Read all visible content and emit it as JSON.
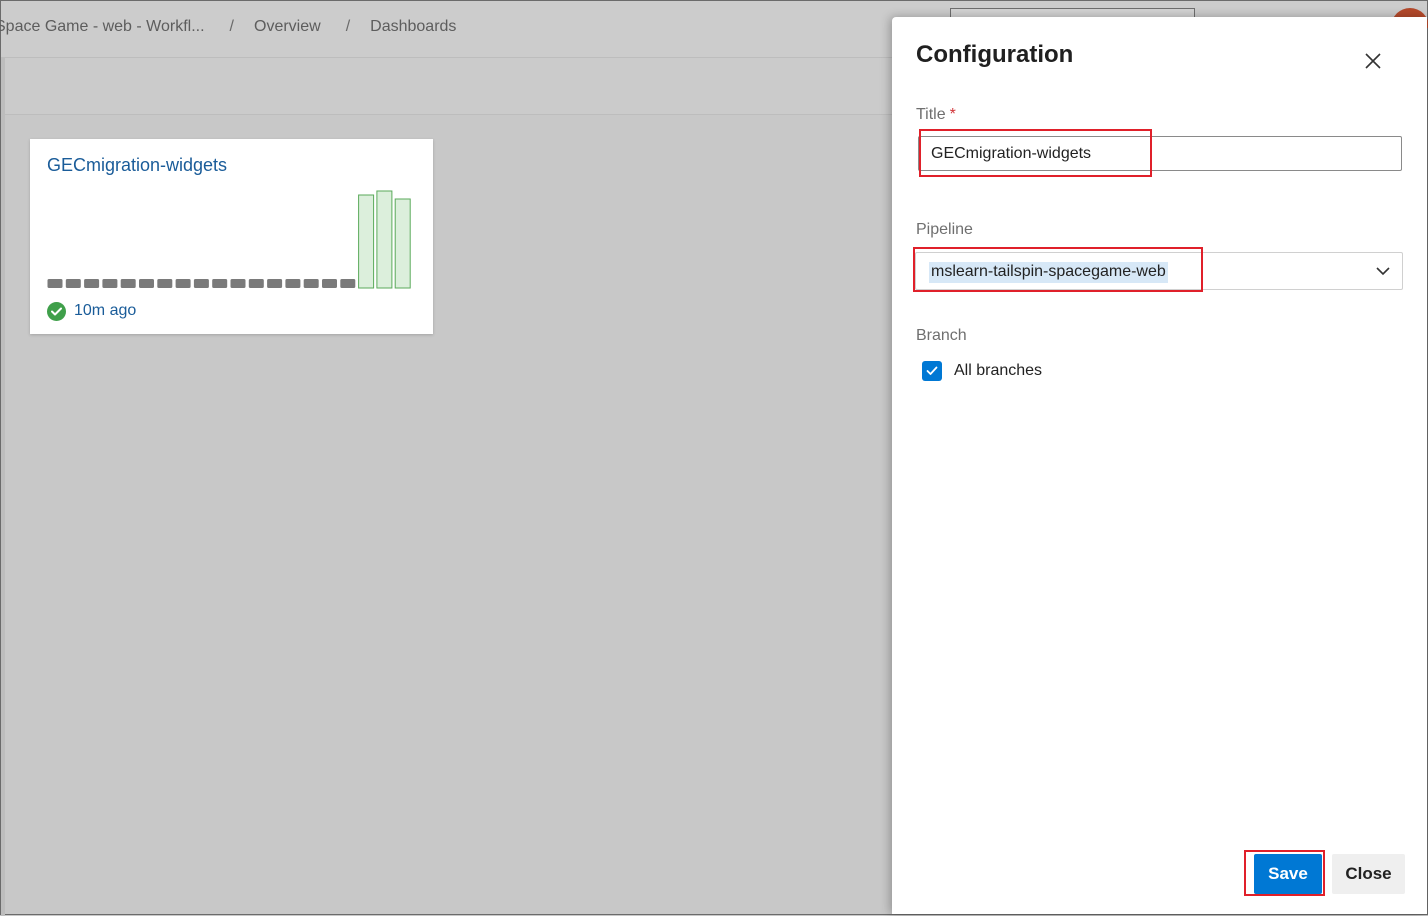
{
  "breadcrumb": {
    "items": [
      "Space Game - web - Workfl...",
      "Overview",
      "Dashboards"
    ],
    "separator": "/"
  },
  "widget": {
    "title": "GECmigration-widgets",
    "status_time": "10m ago",
    "status_icon": "check-circle-icon",
    "build_history": {
      "builds": [
        "none",
        "none",
        "none",
        "none",
        "none",
        "none",
        "none",
        "none",
        "none",
        "none",
        "none",
        "none",
        "none",
        "none",
        "none",
        "none",
        "none",
        "succeeded",
        "succeeded",
        "succeeded"
      ],
      "colors": {
        "none": "#7a7a7a",
        "succeeded_fill": "#dcefdc",
        "succeeded_border": "#5aaa5a"
      }
    }
  },
  "panel": {
    "title": "Configuration",
    "close_icon": "close-icon",
    "title_field": {
      "label": "Title",
      "required_marker": "*",
      "value": "GECmigration-widgets"
    },
    "pipeline_field": {
      "label": "Pipeline",
      "value": "mslearn-tailspin-spacegame-web",
      "icon": "chevron-down-icon"
    },
    "branch_field": {
      "label": "Branch",
      "checkbox_label": "All branches",
      "checked": true
    },
    "save_label": "Save",
    "close_label": "Close"
  },
  "colors": {
    "accent": "#0078d4",
    "link": "#1a5c99",
    "success": "#3f9f4a",
    "highlight": "#e0202a",
    "required": "#d13438"
  }
}
